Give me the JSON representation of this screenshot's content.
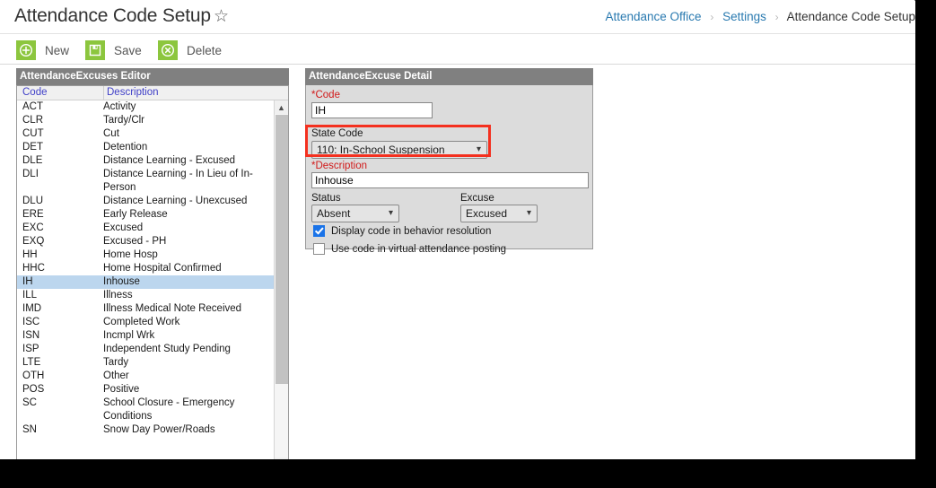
{
  "header": {
    "title": "Attendance Code Setup",
    "favorite_icon": "star-outline-icon"
  },
  "breadcrumb": {
    "items": [
      {
        "label": "Attendance Office",
        "current": false
      },
      {
        "label": "Settings",
        "current": false
      },
      {
        "label": "Attendance Code Setup",
        "current": true
      }
    ],
    "separator": "›"
  },
  "toolbar": {
    "new_label": "New",
    "save_label": "Save",
    "delete_label": "Delete",
    "new_icon": "plus-circle-icon",
    "save_icon": "floppy-disk-icon",
    "delete_icon": "x-circle-icon",
    "icon_color": "#8cc63e"
  },
  "list_panel": {
    "header": "AttendanceExcuses Editor",
    "columns": [
      "Code",
      "Description"
    ],
    "selected_code": "IH",
    "rows": [
      {
        "code": "ACT",
        "description": "Activity"
      },
      {
        "code": "CLR",
        "description": "Tardy/Clr"
      },
      {
        "code": "CUT",
        "description": "Cut"
      },
      {
        "code": "DET",
        "description": "Detention"
      },
      {
        "code": "DLE",
        "description": "Distance Learning - Excused"
      },
      {
        "code": "DLI",
        "description": "Distance Learning - In Lieu of In-Person"
      },
      {
        "code": "DLU",
        "description": "Distance Learning - Unexcused"
      },
      {
        "code": "ERE",
        "description": "Early Release"
      },
      {
        "code": "EXC",
        "description": "Excused"
      },
      {
        "code": "EXQ",
        "description": "Excused - PH"
      },
      {
        "code": "HH",
        "description": "Home Hosp"
      },
      {
        "code": "HHC",
        "description": "Home Hospital Confirmed"
      },
      {
        "code": "IH",
        "description": "Inhouse"
      },
      {
        "code": "ILL",
        "description": "Illness"
      },
      {
        "code": "IMD",
        "description": "Illness Medical Note Received"
      },
      {
        "code": "ISC",
        "description": "Completed Work"
      },
      {
        "code": "ISN",
        "description": "Incmpl Wrk"
      },
      {
        "code": "ISP",
        "description": "Independent Study Pending"
      },
      {
        "code": "LTE",
        "description": "Tardy"
      },
      {
        "code": "OTH",
        "description": "Other"
      },
      {
        "code": "POS",
        "description": "Positive"
      },
      {
        "code": "SC",
        "description": "School Closure - Emergency Conditions"
      },
      {
        "code": "SN",
        "description": "Snow Day Power/Roads"
      }
    ],
    "scrollbar": {
      "up_icon": "chevron-up-icon",
      "down_icon": "chevron-down-icon"
    }
  },
  "detail_panel": {
    "header": "AttendanceExcuse Detail",
    "code": {
      "label": "*Code",
      "value": "IH",
      "required": true
    },
    "state_code": {
      "label": "State Code",
      "value": "110: In-School Suspension",
      "required": false,
      "highlight_color": "#f4301f",
      "highlighted": true
    },
    "description": {
      "label": "*Description",
      "value": "Inhouse",
      "required": true
    },
    "status": {
      "label": "Status",
      "value": "Absent"
    },
    "excuse": {
      "label": "Excuse",
      "value": "Excused"
    },
    "checkboxes": [
      {
        "label": "Display code in behavior resolution",
        "checked": true
      },
      {
        "label": "Use code in virtual attendance posting",
        "checked": false
      }
    ],
    "dropdown_caret_icon": "chevron-down-icon"
  }
}
